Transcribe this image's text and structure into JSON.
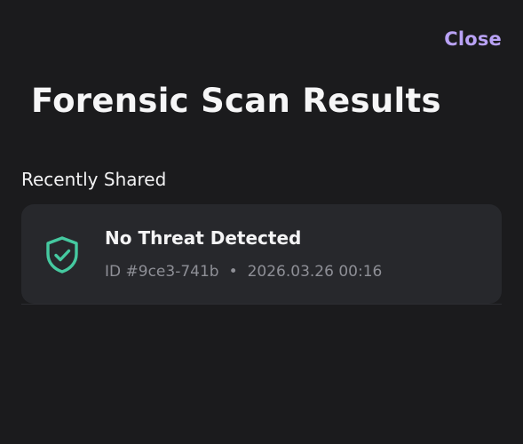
{
  "header": {
    "close_label": "Close",
    "title": "Forensic Scan Results"
  },
  "section": {
    "label": "Recently Shared"
  },
  "results": [
    {
      "icon": "shield-check-icon",
      "status": "No Threat Detected",
      "id": "ID #9ce3-741b",
      "separator": "•",
      "timestamp": "2026.03.26 00:16"
    }
  ],
  "colors": {
    "accent": "#b9a2f5",
    "safe": "#45c9a0",
    "background": "#1b1b1d",
    "card": "#27282c"
  }
}
